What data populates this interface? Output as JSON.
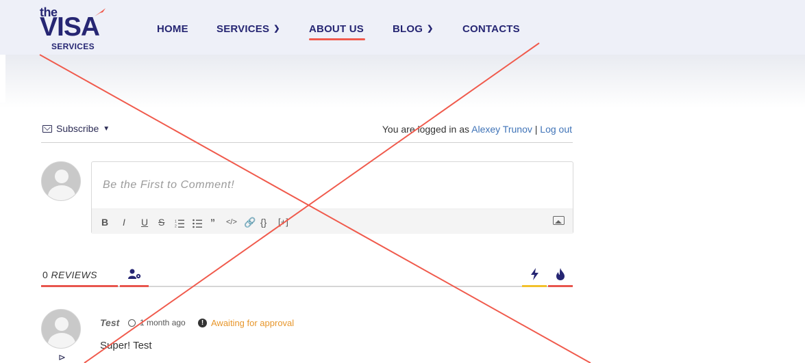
{
  "brand": {
    "logo_line1": "the",
    "logo_line2": "VISA",
    "logo_line3": "SERVICES",
    "primary_color": "#262673",
    "accent_color": "#f05a4c"
  },
  "nav": {
    "items": [
      {
        "label": "HOME",
        "has_dropdown": false
      },
      {
        "label": "SERVICES",
        "has_dropdown": true
      },
      {
        "label": "ABOUT US",
        "has_dropdown": false,
        "active": true
      },
      {
        "label": "BLOG",
        "has_dropdown": true
      },
      {
        "label": "CONTACTS",
        "has_dropdown": false
      }
    ]
  },
  "comments": {
    "subscribe_label": "Subscribe",
    "login_prefix": "You are logged in as",
    "user_name": "Alexey Trunov",
    "separator": "|",
    "logout_label": "Log out",
    "input_placeholder": "Be the First to Comment!",
    "toolbar": [
      "B",
      "I",
      "U",
      "S",
      "ordered-list",
      "unordered-list",
      "quote",
      "code",
      "link",
      "code-block",
      "[+]"
    ],
    "reviews_count": "0",
    "reviews_word": "REVIEWS",
    "entry": {
      "author": "Test",
      "time": "1 month ago",
      "status": "Awaiting for approval",
      "text": "Super! Test"
    }
  },
  "colors": {
    "link": "#3f73b7",
    "pending": "#e7962b",
    "overlay_cross": "#f05a4c"
  }
}
